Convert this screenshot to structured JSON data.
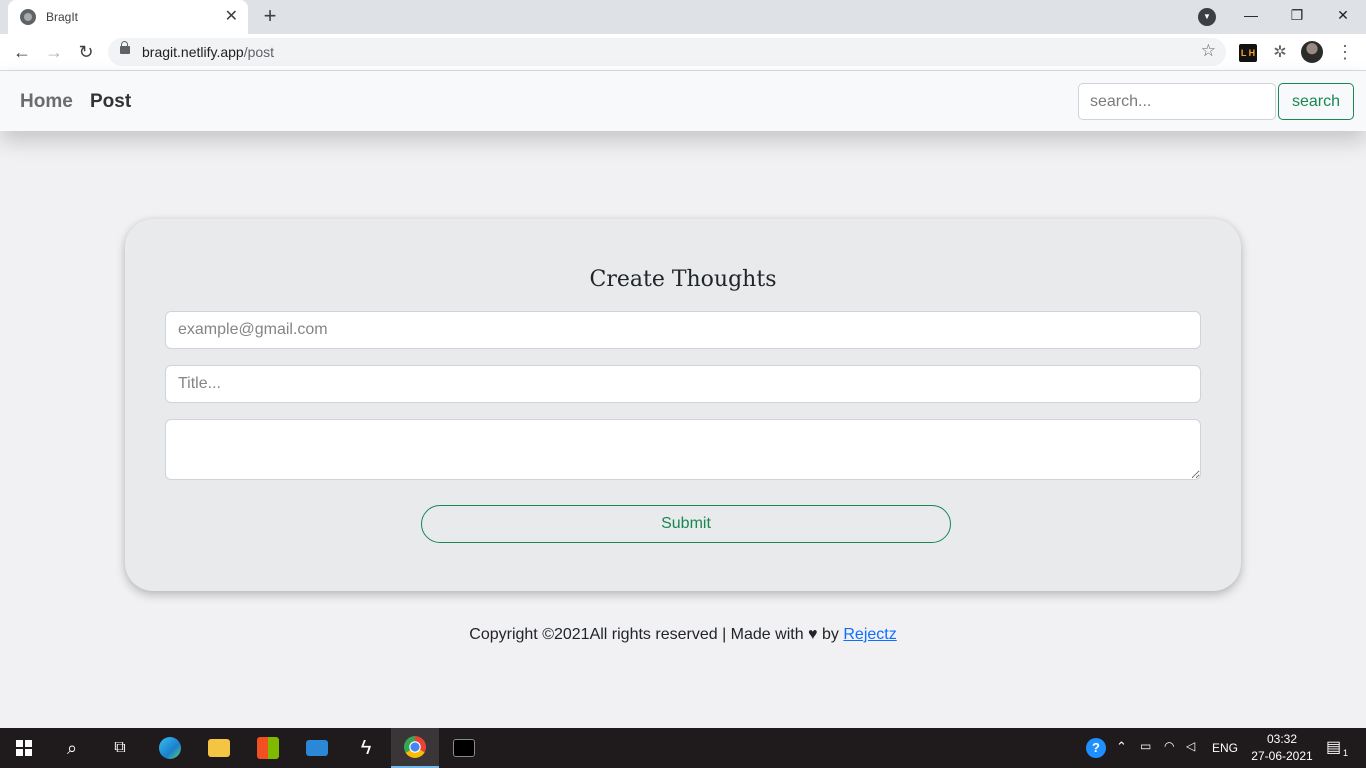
{
  "browser": {
    "tab_title": "BragIt",
    "url_host": "bragit.netlify.app",
    "url_path": "/post"
  },
  "navbar": {
    "home_label": "Home",
    "post_label": "Post",
    "search_placeholder": "search...",
    "search_button": "search"
  },
  "form": {
    "title": "Create Thoughts",
    "email_placeholder": "example@gmail.com",
    "title_placeholder": "Title...",
    "submit_label": "Submit"
  },
  "footer": {
    "text_before": "Copyright ©2021All rights reserved | Made with",
    "text_by": "by",
    "link_text": "Rejectz"
  },
  "taskbar": {
    "lang": "ENG",
    "time": "03:32",
    "date": "27-06-2021",
    "notification_count": "1"
  },
  "colors": {
    "accent_green": "#198754",
    "link_blue": "#0d6efd"
  }
}
